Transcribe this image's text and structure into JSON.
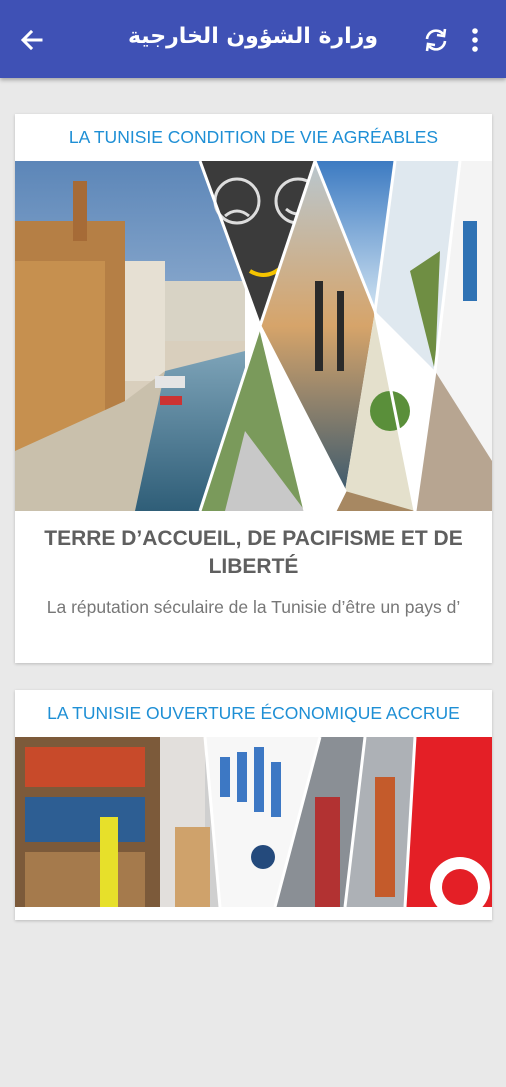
{
  "appbar": {
    "title": "وزارة الشؤون الخارجية",
    "back_icon": "arrow-left-icon",
    "refresh_icon": "refresh-icon",
    "menu_icon": "more-vert-icon"
  },
  "colors": {
    "appbar": "#3f51b5",
    "accent_text": "#1e8fd5",
    "background": "#e9e9e9"
  },
  "articles": [
    {
      "category": "LA TUNISIE CONDITION DE VIE AGRÉABLES",
      "headline": "TERRE D’ACCUEIL, DE PACIFISME ET DE LIBERTÉ",
      "excerpt": "La réputation séculaire de la Tunisie d’être un pays d’"
    },
    {
      "category": "LA TUNISIE OUVERTURE ÉCONOMIQUE ACCRUE"
    }
  ]
}
